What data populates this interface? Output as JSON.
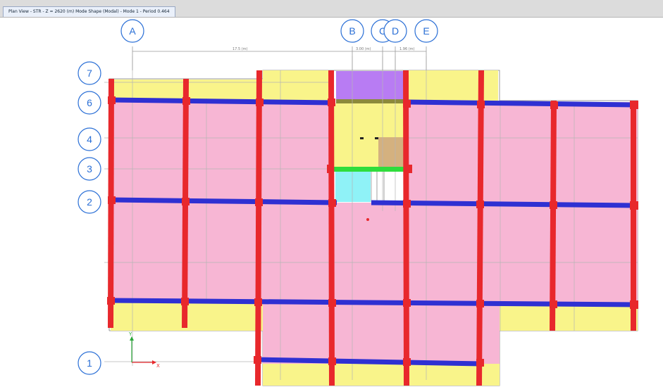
{
  "window": {
    "title": "Plan View - STR - Z = 2620 (m)   Mode Shape (Modal) - Mode 1 - Period 0.464"
  },
  "grid": {
    "columns": [
      {
        "label": "A"
      },
      {
        "label": "B"
      },
      {
        "label": "C"
      },
      {
        "label": "D"
      },
      {
        "label": "E"
      }
    ],
    "rows": [
      {
        "label": "7"
      },
      {
        "label": "6"
      },
      {
        "label": "4"
      },
      {
        "label": "3"
      },
      {
        "label": "2"
      },
      {
        "label": "1"
      }
    ]
  },
  "dimensions": {
    "a_to_b": "17.5 (m)",
    "b_to_c": "3.00 (m)",
    "c_to_e": "1.96 (m)"
  },
  "axis": {
    "x_label": "X",
    "y_label": "Y"
  },
  "colors": {
    "frame_column": "#e8282c",
    "frame_beam": "#2f30d2",
    "slab_pink": "#f7b6d4",
    "slab_yellow": "#f9f48a",
    "wall_purple": "#b87cf3",
    "slab_tan": "#d4b17f",
    "slab_cyan": "#8ff2f7",
    "beam_green": "#2fdd3c",
    "grid_bubble": "#2a6fd6",
    "grid_line": "#b5b5b5"
  }
}
